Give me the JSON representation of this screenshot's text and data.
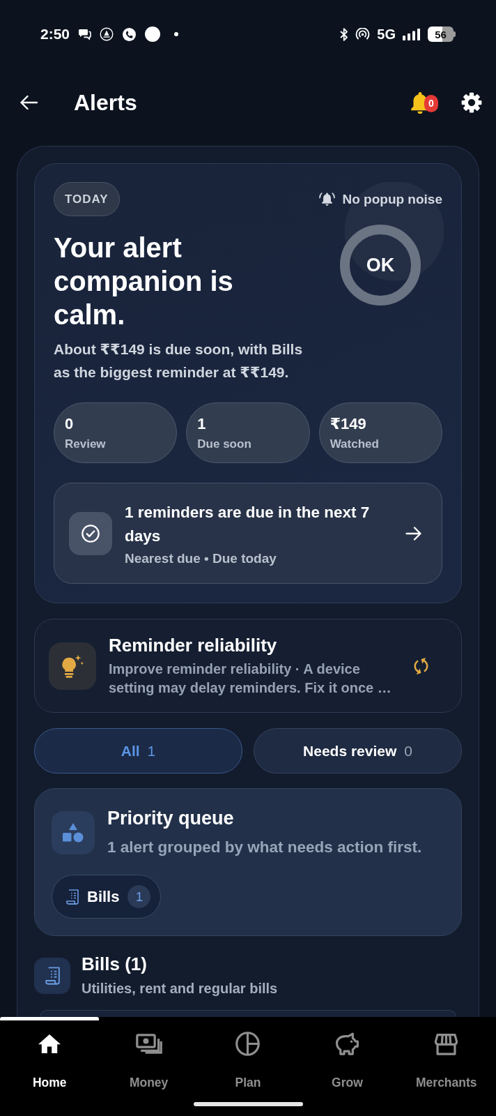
{
  "status_bar": {
    "time": "2:50",
    "network": "5G",
    "battery": "56"
  },
  "header": {
    "title": "Alerts",
    "badge": "0"
  },
  "hero": {
    "tag": "TODAY",
    "sound_note": "No popup noise",
    "heading": "Your alert companion is calm.",
    "status": "OK",
    "summary": "About ₹₹149 is due soon, with Bills as the biggest reminder at ₹₹149.",
    "stats": [
      {
        "value": "0",
        "label": "Review"
      },
      {
        "value": "1",
        "label": "Due soon"
      },
      {
        "value": "₹149",
        "label": "Watched"
      }
    ],
    "reminder": {
      "title": "1 reminders are due in the next 7 days",
      "subtitle": "Nearest due • Due today"
    }
  },
  "reliability": {
    "title": "Reminder reliability",
    "description": "Improve reminder reliability · A device setting may delay reminders. Fix it once …"
  },
  "filter_tabs": [
    {
      "label": "All",
      "count": "1",
      "selected": true
    },
    {
      "label": "Needs review",
      "count": "0",
      "selected": false
    }
  ],
  "priority_queue": {
    "title": "Priority queue",
    "subtitle": "1 alert grouped by what needs action first.",
    "chips": [
      {
        "label": "Bills",
        "count": "1"
      }
    ]
  },
  "category": {
    "title": "Bills (1)",
    "subtitle": "Utilities, rent and regular bills"
  },
  "bottom_nav": [
    {
      "label": "Home",
      "selected": true
    },
    {
      "label": "Money",
      "selected": false
    },
    {
      "label": "Plan",
      "selected": false
    },
    {
      "label": "Grow",
      "selected": false
    },
    {
      "label": "Merchants",
      "selected": false
    }
  ]
}
